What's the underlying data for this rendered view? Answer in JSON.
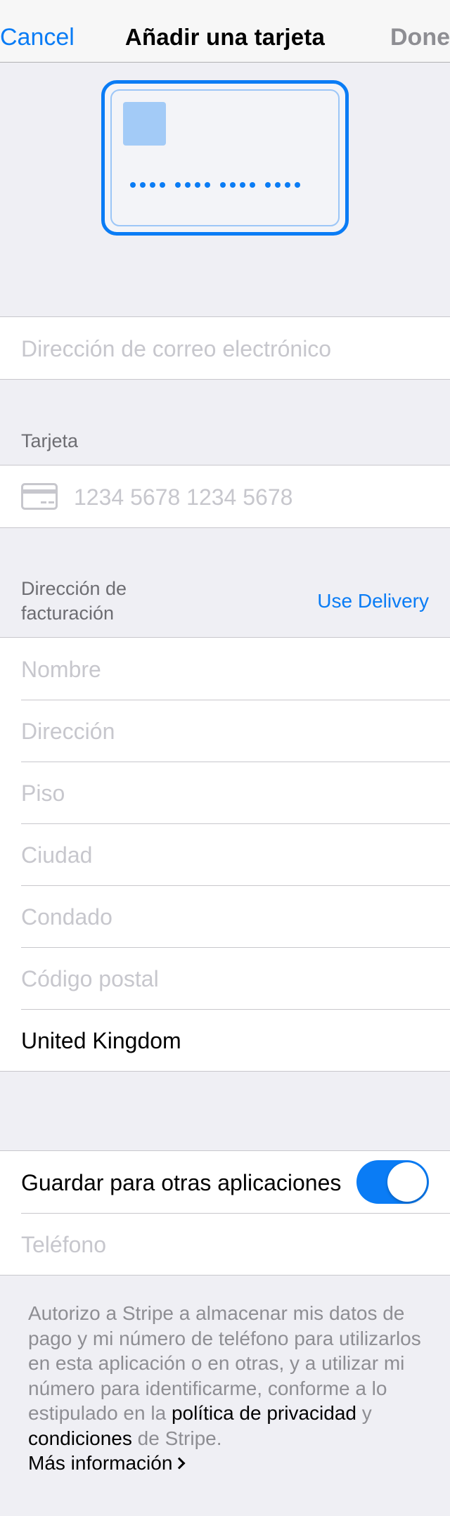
{
  "nav": {
    "cancel": "Cancel",
    "title": "Añadir una tarjeta",
    "done": "Done"
  },
  "email": {
    "placeholder": "Dirección de correo electrónico"
  },
  "card_section": {
    "label": "Tarjeta",
    "placeholder": "1234 5678 1234 5678",
    "icon": "credit-card-icon"
  },
  "billing": {
    "label_line1": "Dirección de",
    "label_line2": "facturación",
    "use_delivery": "Use Delivery",
    "fields": {
      "name": "Nombre",
      "address": "Dirección",
      "floor": "Piso",
      "city": "Ciudad",
      "county": "Condado",
      "postal": "Código postal"
    },
    "country": "United Kingdom"
  },
  "save": {
    "label": "Guardar para otras aplicaciones",
    "toggle_on": true,
    "phone_placeholder": "Teléfono"
  },
  "footer": {
    "text1": "Autorizo a Stripe a almacenar mis datos de pago y mi número de teléfono para utilizarlos en esta aplicación o en otras, y a utilizar mi número para identificarme, conforme a lo estipulado en la ",
    "privacy_link": "política de privacidad",
    "and": " y ",
    "terms_link": "condiciones",
    "text2": " de Stripe.",
    "more_info": "Más información"
  },
  "colors": {
    "accent": "#0a7cf5",
    "background": "#efeff4",
    "placeholder": "#c7c7cd",
    "secondary_text": "#8e8e93"
  }
}
